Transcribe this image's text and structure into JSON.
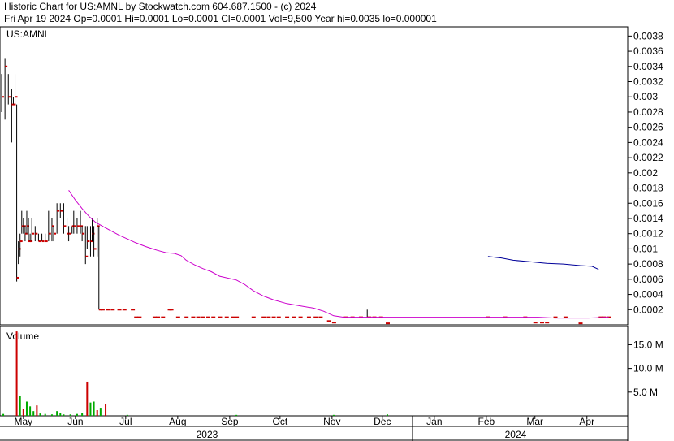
{
  "header": {
    "line1": "Historic Chart for US:AMNL by Stockwatch.com 604.687.1500 - (c) 2024",
    "line2": "Fri Apr 19 2024  Op=0.0001  Hi=0.0001  Lo=0.0001  Cl=0.0001  Vol=9,500  Year hi=0.0035  lo=0.000001"
  },
  "chart_data": [
    {
      "type": "bar",
      "title": "US:AMNL",
      "subtype": "ohlc-price",
      "x_axis": {
        "months": [
          {
            "label": "May",
            "day": 13
          },
          {
            "label": "Jun",
            "day": 44
          },
          {
            "label": "Jul",
            "day": 74
          },
          {
            "label": "Aug",
            "day": 105
          },
          {
            "label": "Sep",
            "day": 136
          },
          {
            "label": "Oct",
            "day": 166
          },
          {
            "label": "Nov",
            "day": 197
          },
          {
            "label": "Dec",
            "day": 227
          },
          {
            "label": "Jan",
            "day": 258
          },
          {
            "label": "Feb",
            "day": 289
          },
          {
            "label": "Mar",
            "day": 318
          },
          {
            "label": "Apr",
            "day": 349
          }
        ],
        "years": [
          {
            "label": "2023",
            "start_day": 0,
            "end_day": 245
          },
          {
            "label": "2024",
            "start_day": 245,
            "end_day": 368
          }
        ],
        "range_days": [
          0,
          368
        ]
      },
      "ylim": [
        0,
        0.0039
      ],
      "yticks": [
        "0.0002",
        "0.0004",
        "0.0006",
        "0.0008",
        "0.001",
        "0.0012",
        "0.0014",
        "0.0016",
        "0.0018",
        "0.002",
        "0.0022",
        "0.0024",
        "0.0026",
        "0.0028",
        "0.003",
        "0.0032",
        "0.0034",
        "0.0036",
        "0.0038"
      ],
      "bar_color": "#000000",
      "tick_color": "#cc0000",
      "bars": [
        {
          "d": 0,
          "h": 0.0033,
          "l": 0.0028,
          "c": 0.003
        },
        {
          "d": 2,
          "h": 0.0035,
          "l": 0.0027,
          "c": 0.0034
        },
        {
          "d": 4,
          "h": 0.0033,
          "l": 0.0029,
          "c": 0.003
        },
        {
          "d": 6,
          "h": 0.0031,
          "l": 0.0024,
          "c": 0.0029
        },
        {
          "d": 7,
          "h": 0.003,
          "l": 0.0029,
          "c": 0.0029
        },
        {
          "d": 8,
          "h": 0.0033,
          "l": 0.0029,
          "c": 0.003
        },
        {
          "d": 9,
          "h": 0.0029,
          "l": 0.00057,
          "c": 0.00062
        },
        {
          "d": 10,
          "h": 0.0011,
          "l": 0.0008,
          "c": 0.001
        },
        {
          "d": 11,
          "h": 0.0012,
          "l": 0.0009,
          "c": 0.0011
        },
        {
          "d": 12,
          "h": 0.0015,
          "l": 0.0012,
          "c": 0.0013
        },
        {
          "d": 13,
          "h": 0.0014,
          "l": 0.0012,
          "c": 0.0013
        },
        {
          "d": 14,
          "h": 0.0013,
          "l": 0.0011,
          "c": 0.0012
        },
        {
          "d": 15,
          "h": 0.0015,
          "l": 0.0012,
          "c": 0.0013
        },
        {
          "d": 16,
          "h": 0.0014,
          "l": 0.0011,
          "c": 0.0011
        },
        {
          "d": 17,
          "h": 0.0012,
          "l": 0.0011,
          "c": 0.0011
        },
        {
          "d": 18,
          "h": 0.0014,
          "l": 0.0011,
          "c": 0.0012
        },
        {
          "d": 20,
          "h": 0.0013,
          "l": 0.0011,
          "c": 0.0012
        },
        {
          "d": 22,
          "h": 0.0012,
          "l": 0.0011,
          "c": 0.0011
        },
        {
          "d": 24,
          "h": 0.0012,
          "l": 0.0011,
          "c": 0.0011
        },
        {
          "d": 26,
          "h": 0.0012,
          "l": 0.0011,
          "c": 0.0011
        },
        {
          "d": 28,
          "h": 0.0015,
          "l": 0.0011,
          "c": 0.0012
        },
        {
          "d": 30,
          "h": 0.0014,
          "l": 0.0011,
          "c": 0.0013
        },
        {
          "d": 31,
          "h": 0.0013,
          "l": 0.0011,
          "c": 0.0012
        },
        {
          "d": 33,
          "h": 0.0016,
          "l": 0.0012,
          "c": 0.0015
        },
        {
          "d": 35,
          "h": 0.0016,
          "l": 0.0014,
          "c": 0.0015
        },
        {
          "d": 37,
          "h": 0.0016,
          "l": 0.0012,
          "c": 0.0013
        },
        {
          "d": 39,
          "h": 0.0014,
          "l": 0.0011,
          "c": 0.0012
        },
        {
          "d": 40,
          "h": 0.0013,
          "l": 0.0011,
          "c": 0.0012
        },
        {
          "d": 42,
          "h": 0.0013,
          "l": 0.0012,
          "c": 0.0013
        },
        {
          "d": 43,
          "h": 0.0015,
          "l": 0.0012,
          "c": 0.0013
        },
        {
          "d": 45,
          "h": 0.0014,
          "l": 0.0012,
          "c": 0.0013
        },
        {
          "d": 47,
          "h": 0.0015,
          "l": 0.0012,
          "c": 0.0013
        },
        {
          "d": 48,
          "h": 0.0013,
          "l": 0.0011,
          "c": 0.0012
        },
        {
          "d": 50,
          "h": 0.0013,
          "l": 0.0008,
          "c": 0.0009
        },
        {
          "d": 51,
          "h": 0.0013,
          "l": 0.001,
          "c": 0.0011
        },
        {
          "d": 53,
          "h": 0.0013,
          "l": 0.0009,
          "c": 0.0011
        },
        {
          "d": 54,
          "h": 0.0014,
          "l": 0.0011,
          "c": 0.0012
        },
        {
          "d": 55,
          "h": 0.0013,
          "l": 0.0009,
          "c": 0.001
        },
        {
          "d": 57,
          "h": 0.0014,
          "l": 0.0009,
          "c": 0.0013
        },
        {
          "d": 58,
          "h": 0.0013,
          "l": 0.0002,
          "c": 0.0002
        }
      ],
      "ticks": [
        {
          "d": 60,
          "v": 0.0002
        },
        {
          "d": 63,
          "v": 0.0002
        },
        {
          "d": 66,
          "v": 0.0002
        },
        {
          "d": 70,
          "v": 0.0002
        },
        {
          "d": 73,
          "v": 0.0002
        },
        {
          "d": 78,
          "v": 0.0002
        },
        {
          "d": 80,
          "v": 0.0001
        },
        {
          "d": 82,
          "v": 0.0001
        },
        {
          "d": 91,
          "v": 0.0001
        },
        {
          "d": 93,
          "v": 0.0001
        },
        {
          "d": 96,
          "v": 0.0001
        },
        {
          "d": 100,
          "v": 0.0002
        },
        {
          "d": 101,
          "v": 0.0002
        },
        {
          "d": 105,
          "v": 0.0001
        },
        {
          "d": 110,
          "v": 0.0001
        },
        {
          "d": 114,
          "v": 0.0001
        },
        {
          "d": 117,
          "v": 0.0001
        },
        {
          "d": 120,
          "v": 0.0001
        },
        {
          "d": 123,
          "v": 0.0001
        },
        {
          "d": 126,
          "v": 0.0001
        },
        {
          "d": 130,
          "v": 0.0001
        },
        {
          "d": 134,
          "v": 0.0001
        },
        {
          "d": 138,
          "v": 0.0001
        },
        {
          "d": 140,
          "v": 0.0001
        },
        {
          "d": 150,
          "v": 0.0001
        },
        {
          "d": 156,
          "v": 0.0001
        },
        {
          "d": 159,
          "v": 0.0001
        },
        {
          "d": 162,
          "v": 0.0001
        },
        {
          "d": 165,
          "v": 0.0001
        },
        {
          "d": 170,
          "v": 0.0001
        },
        {
          "d": 174,
          "v": 0.0001
        },
        {
          "d": 178,
          "v": 0.0001
        },
        {
          "d": 183,
          "v": 0.0001
        },
        {
          "d": 187,
          "v": 0.0001
        },
        {
          "d": 190,
          "v": 0.0001
        },
        {
          "d": 195,
          "v": 5e-05
        },
        {
          "d": 198,
          "v": 3e-05
        },
        {
          "d": 205,
          "v": 0.0001
        },
        {
          "d": 209,
          "v": 0.0001
        },
        {
          "d": 214,
          "v": 0.0001
        },
        {
          "d": 219,
          "v": 0.0001
        },
        {
          "d": 222,
          "v": 0.0001
        },
        {
          "d": 226,
          "v": 0.0001
        },
        {
          "d": 230,
          "v": 2e-05
        },
        {
          "d": 290,
          "v": 0.0001
        },
        {
          "d": 300,
          "v": 0.0001
        },
        {
          "d": 312,
          "v": 0.0001
        },
        {
          "d": 318,
          "v": 3e-05
        },
        {
          "d": 322,
          "v": 3e-05
        },
        {
          "d": 325,
          "v": 3e-05
        },
        {
          "d": 330,
          "v": 0.0001
        },
        {
          "d": 336,
          "v": 0.0001
        },
        {
          "d": 345,
          "v": 2e-05
        },
        {
          "d": 357,
          "v": 0.0001
        },
        {
          "d": 359,
          "v": 0.0001
        },
        {
          "d": 362,
          "v": 0.0001
        }
      ],
      "spikes": [
        {
          "d": 218,
          "h": 0.0002,
          "l": 0.0001
        }
      ],
      "series": [
        {
          "kind": "moving-average",
          "color": "#cc00cc",
          "points": [
            [
              40,
              0.00177
            ],
            [
              44,
              0.00164
            ],
            [
              48,
              0.00153
            ],
            [
              52,
              0.00143
            ],
            [
              56,
              0.00135
            ],
            [
              60,
              0.0013
            ],
            [
              65,
              0.00124
            ],
            [
              70,
              0.00118
            ],
            [
              75,
              0.00113
            ],
            [
              80,
              0.00108
            ],
            [
              86,
              0.00103
            ],
            [
              90,
              0.001
            ],
            [
              93,
              0.00098
            ],
            [
              98,
              0.00095
            ],
            [
              103,
              0.00094
            ],
            [
              107,
              0.00091
            ],
            [
              110,
              0.00085
            ],
            [
              115,
              0.00079
            ],
            [
              120,
              0.00074
            ],
            [
              125,
              0.0007
            ],
            [
              130,
              0.00064
            ],
            [
              140,
              0.00059
            ],
            [
              145,
              0.00053
            ],
            [
              150,
              0.00045
            ],
            [
              156,
              0.00038
            ],
            [
              162,
              0.00033
            ],
            [
              170,
              0.00028
            ],
            [
              178,
              0.00025
            ],
            [
              186,
              0.00022
            ],
            [
              192,
              0.00018
            ],
            [
              198,
              0.00012
            ],
            [
              204,
              0.0001
            ],
            [
              215,
              0.0001
            ],
            [
              225,
              0.0001
            ],
            [
              240,
              0.0001
            ],
            [
              260,
              0.0001
            ],
            [
              290,
              0.0001
            ],
            [
              320,
              0.0001
            ],
            [
              330,
              9e-05
            ],
            [
              350,
              9e-05
            ],
            [
              362,
              0.0001
            ]
          ]
        },
        {
          "kind": "moving-average",
          "color": "#000099",
          "points": [
            [
              290,
              0.0009
            ],
            [
              298,
              0.00088
            ],
            [
              305,
              0.00085
            ],
            [
              315,
              0.00083
            ],
            [
              325,
              0.00081
            ],
            [
              335,
              0.0008
            ],
            [
              345,
              0.00078
            ],
            [
              352,
              0.00077
            ],
            [
              356,
              0.00073
            ]
          ]
        }
      ]
    },
    {
      "type": "bar",
      "title": "Volume",
      "yticks": [
        "5.0 M",
        "10.0 M",
        "15.0 M"
      ],
      "ytick_values": [
        5,
        10,
        15
      ],
      "ylim": [
        0,
        18.5
      ],
      "units": "M",
      "colors": {
        "up": "#00aa00",
        "down": "#cc0000"
      },
      "bars": [
        {
          "d": 1,
          "v": 0.4,
          "dir": "up"
        },
        {
          "d": 9,
          "v": 17.8,
          "dir": "down"
        },
        {
          "d": 11,
          "v": 4.2,
          "dir": "up"
        },
        {
          "d": 13,
          "v": 1.5,
          "dir": "down"
        },
        {
          "d": 15,
          "v": 3.0,
          "dir": "up"
        },
        {
          "d": 17,
          "v": 2.0,
          "dir": "up"
        },
        {
          "d": 19,
          "v": 1.0,
          "dir": "up"
        },
        {
          "d": 21,
          "v": 2.2,
          "dir": "down"
        },
        {
          "d": 23,
          "v": 0.5,
          "dir": "up"
        },
        {
          "d": 26,
          "v": 0.4,
          "dir": "up"
        },
        {
          "d": 30,
          "v": 0.3,
          "dir": "up"
        },
        {
          "d": 33,
          "v": 1.0,
          "dir": "up"
        },
        {
          "d": 35,
          "v": 0.6,
          "dir": "up"
        },
        {
          "d": 37,
          "v": 0.3,
          "dir": "up"
        },
        {
          "d": 41,
          "v": 0.3,
          "dir": "up"
        },
        {
          "d": 45,
          "v": 0.4,
          "dir": "up"
        },
        {
          "d": 48,
          "v": 0.6,
          "dir": "up"
        },
        {
          "d": 51,
          "v": 7.2,
          "dir": "down"
        },
        {
          "d": 53,
          "v": 2.8,
          "dir": "up"
        },
        {
          "d": 55,
          "v": 3.0,
          "dir": "up"
        },
        {
          "d": 57,
          "v": 1.2,
          "dir": "down"
        },
        {
          "d": 59,
          "v": 1.7,
          "dir": "up"
        },
        {
          "d": 62,
          "v": 2.5,
          "dir": "down"
        },
        {
          "d": 75,
          "v": 0.2,
          "dir": "up"
        },
        {
          "d": 140,
          "v": 0.2,
          "dir": "up"
        },
        {
          "d": 198,
          "v": 0.2,
          "dir": "up"
        },
        {
          "d": 230,
          "v": 0.3,
          "dir": "up"
        }
      ]
    }
  ]
}
